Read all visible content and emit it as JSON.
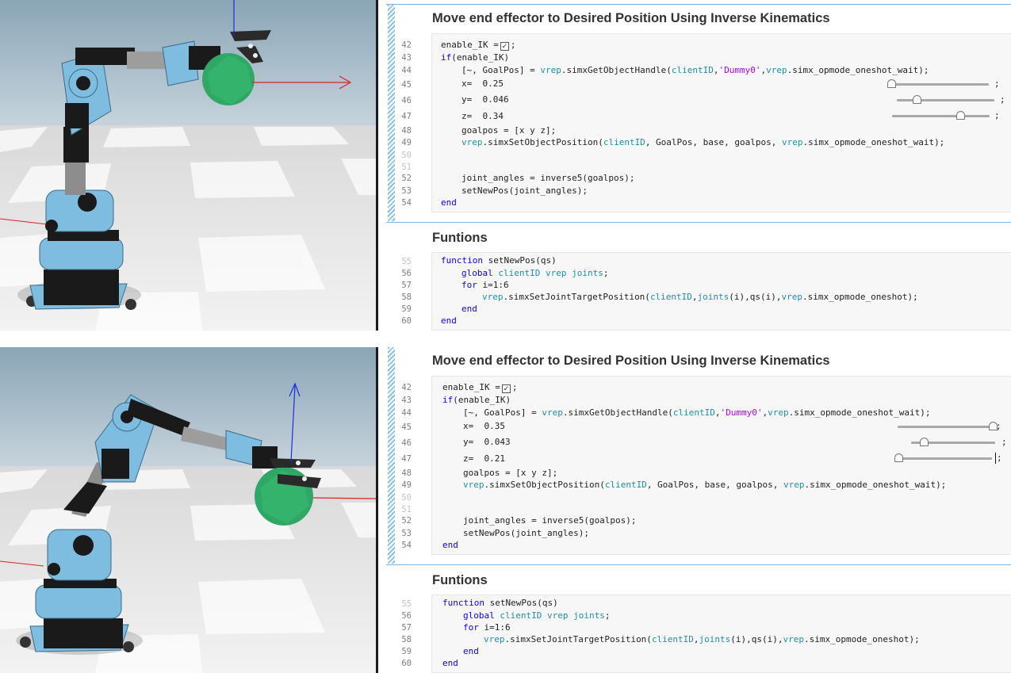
{
  "top": {
    "section1": {
      "title": "Move end effector to Desired Position Using Inverse Kinematics",
      "line_numbers": [
        "42",
        "43",
        "44",
        "45",
        "46",
        "47",
        "48",
        "49",
        "50",
        "51",
        "52",
        "53",
        "54"
      ],
      "lines": {
        "l42": {
          "text": "enable_IK =",
          "after": ";"
        },
        "l43_kw": "if",
        "l43_rest": "(enable_IK)",
        "l44_a": "[~, GoalPos] = ",
        "l44_b": "vrep",
        "l44_c": ".simxGetObjectHandle(",
        "l44_d": "clientID",
        "l44_e": ",",
        "l44_f": "'Dummy0'",
        "l44_g": ",",
        "l44_h": "vrep",
        "l44_i": ".simx_opmode_oneshot_wait);",
        "x_label": "x=  0.25",
        "y_label": "y=  0.046",
        "z_label": "z=  0.34",
        "l48": "goalpos = [x y z];",
        "l49_a": "vrep",
        "l49_b": ".simxSetObjectPosition(",
        "l49_c": "clientID",
        "l49_d": ", GoalPos, base, goalpos, ",
        "l49_e": "vrep",
        "l49_f": ".simx_opmode_oneshot_wait);",
        "l52": "joint_angles = inverse5(goalpos);",
        "l53": "setNewPos(joint_angles);",
        "l54": "end"
      },
      "sliders": {
        "x": 0.0,
        "y": 0.2,
        "z": 0.7
      }
    },
    "section2": {
      "title": "Funtions",
      "line_numbers": [
        "55",
        "56",
        "57",
        "58",
        "59",
        "60"
      ],
      "lines": {
        "l55_kw": "function",
        "l55_rest": " setNewPos(qs)",
        "l56_kw": "global",
        "l56_vars": " clientID vrep joints",
        "l56_end": ";",
        "l57_kw": "for",
        "l57_rest": " i=1:6",
        "l58_a": "vrep",
        "l58_b": ".simxSetJointTargetPosition(",
        "l58_c": "clientID",
        "l58_d": ",",
        "l58_e": "joints",
        "l58_f": "(i),qs(i),",
        "l58_g": "vrep",
        "l58_h": ".simx_opmode_oneshot);",
        "l59": "end",
        "l60": "end"
      }
    }
  },
  "bottom": {
    "section1": {
      "title": "Move end effector to Desired Position Using Inverse Kinematics",
      "line_numbers": [
        "42",
        "43",
        "44",
        "45",
        "46",
        "47",
        "48",
        "49",
        "50",
        "51",
        "52",
        "53",
        "54"
      ],
      "lines": {
        "l42": {
          "text": "enable_IK =",
          "after": ";"
        },
        "l43_kw": "if",
        "l43_rest": "(enable_IK)",
        "l44_a": "[~, GoalPos] = ",
        "l44_b": "vrep",
        "l44_c": ".simxGetObjectHandle(",
        "l44_d": "clientID",
        "l44_e": ",",
        "l44_f": "'Dummy0'",
        "l44_g": ",",
        "l44_h": "vrep",
        "l44_i": ".simx_opmode_oneshot_wait);",
        "x_label": "x=  0.35",
        "y_label": "y=  0.043",
        "z_label": "z=  0.21",
        "l48": "goalpos = [x y z];",
        "l49_a": "vrep",
        "l49_b": ".simxSetObjectPosition(",
        "l49_c": "clientID",
        "l49_d": ", GoalPos, base, goalpos, ",
        "l49_e": "vrep",
        "l49_f": ".simx_opmode_oneshot_wait);",
        "l52": "joint_angles = inverse5(goalpos);",
        "l53": "setNewPos(joint_angles);",
        "l54": "end"
      },
      "sliders": {
        "x": 1.0,
        "y": 0.15,
        "z": 0.0
      }
    },
    "section2": {
      "title": "Funtions",
      "line_numbers": [
        "55",
        "56",
        "57",
        "58",
        "59",
        "60"
      ],
      "lines": {
        "l55_kw": "function",
        "l55_rest": " setNewPos(qs)",
        "l56_kw": "global",
        "l56_vars": " clientID vrep joints",
        "l56_end": ";",
        "l57_kw": "for",
        "l57_rest": " i=1:6",
        "l58_a": "vrep",
        "l58_b": ".simxSetJointTargetPosition(",
        "l58_c": "clientID",
        "l58_d": ",",
        "l58_e": "joints",
        "l58_f": "(i),qs(i),",
        "l58_g": "vrep",
        "l58_h": ".simx_opmode_oneshot);",
        "l59": "end",
        "l60": "end"
      }
    }
  },
  "colors": {
    "keyword": "#0e00ff",
    "variable": "#1f8fa6",
    "string": "#a709f5",
    "robot_body": "#7fbde0",
    "target_sphere": "#2ea864"
  },
  "icons": [
    "checkbox-checked-icon",
    "slider-thumb-icon"
  ]
}
